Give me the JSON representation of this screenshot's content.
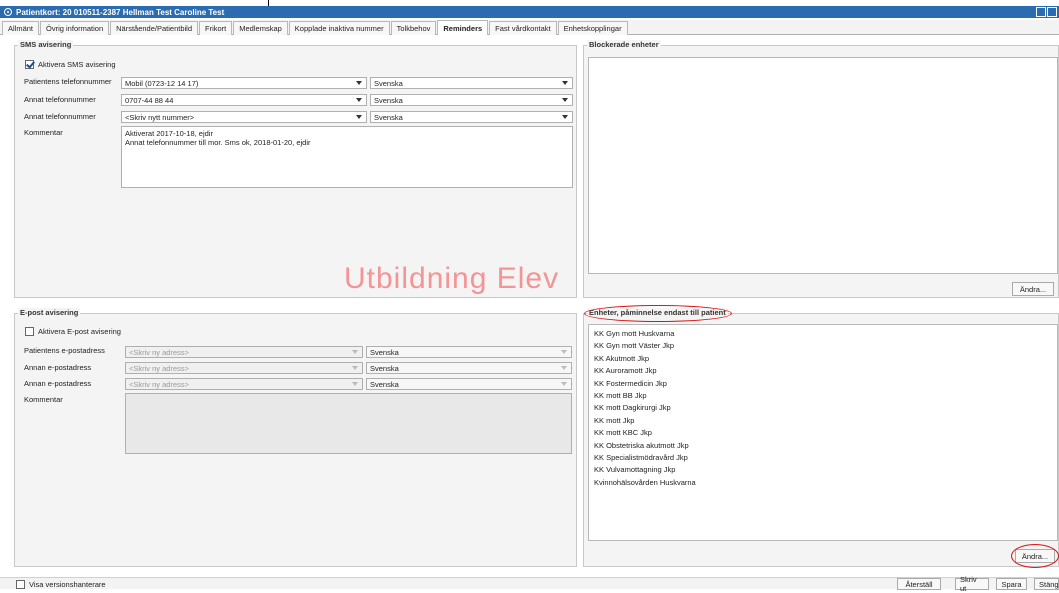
{
  "window": {
    "title": "Patientkort: 20 010511-2387 Hellman Test Caroline Test"
  },
  "tabs": [
    {
      "label": "Allmänt",
      "active": false
    },
    {
      "label": "Övrig information",
      "active": false
    },
    {
      "label": "Närstående/Patientbild",
      "active": false
    },
    {
      "label": "Frikort",
      "active": false
    },
    {
      "label": "Medlemskap",
      "active": false
    },
    {
      "label": "Kopplade inaktiva nummer",
      "active": false
    },
    {
      "label": "Tolkbehov",
      "active": false
    },
    {
      "label": "Reminders",
      "active": true
    },
    {
      "label": "Fast vårdkontakt",
      "active": false
    },
    {
      "label": "Enhetskopplingar",
      "active": false
    }
  ],
  "sms": {
    "title": "SMS avisering",
    "activate_label": "Aktivera SMS avisering",
    "activate_checked": true,
    "rows": [
      {
        "label": "Patientens telefonnummer",
        "value": "Mobil (0723-12 14 17)",
        "language": "Svenska"
      },
      {
        "label": "Annat telefonnummer",
        "value": "0707-44 88 44",
        "language": "Svenska"
      },
      {
        "label": "Annat telefonnummer",
        "value": "<Skriv nytt nummer>",
        "language": "Svenska"
      }
    ],
    "comment_label": "Kommentar",
    "comment_line1": "Aktiverat 2017-10-18, ejdir",
    "comment_line2": "Annat telefonnummer till mor. Sms ok, 2018-01-20, ejdir"
  },
  "blocked": {
    "title": "Blockerade enheter",
    "change_label": "Ändra..."
  },
  "email": {
    "title": "E-post avisering",
    "activate_label": "Aktivera E-post avisering",
    "activate_checked": false,
    "rows": [
      {
        "label": "Patientens e-postadress",
        "value": "<Skriv ny adress>",
        "language": "Svenska"
      },
      {
        "label": "Annan e-postadress",
        "value": "<Skriv ny adress>",
        "language": "Svenska"
      },
      {
        "label": "Annan e-postadress",
        "value": "<Skriv ny adress>",
        "language": "Svenska"
      }
    ],
    "comment_label": "Kommentar"
  },
  "reminder_units": {
    "title": "Enheter, påminnelse endast till patient",
    "change_label": "Ändra...",
    "items": [
      "KK Gyn mott Huskvarna",
      "KK Gyn mott Väster Jkp",
      "KK Akutmott Jkp",
      "KK Auroramott Jkp",
      "KK Fostermedicin Jkp",
      "KK mott BB Jkp",
      "KK mott Dagkirurgi Jkp",
      "KK mott Jkp",
      "KK mott KBC Jkp",
      "KK Obstetriska akutmott Jkp",
      "KK Specialistmödravård Jkp",
      "KK Vulvamottagning Jkp",
      "Kvinnohälsovården Huskvarna"
    ]
  },
  "watermark": "Utbildning Elev",
  "footer": {
    "version_label": "Visa versionshanterare",
    "reset_label": "Återställ",
    "print_label": "Skriv ut",
    "save_label": "Spara",
    "close_label": "Stäng"
  }
}
